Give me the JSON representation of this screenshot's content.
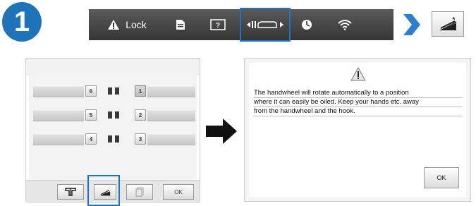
{
  "step": {
    "number": "1",
    "color": "#1f74b9"
  },
  "toolbar": {
    "lock_label": "Lock",
    "icons": [
      "warning-icon",
      "document-icon",
      "help-icon",
      "needle-position-icon",
      "clock-icon",
      "wifi-icon"
    ],
    "highlight_color": "#1a76c4"
  },
  "left_screen": {
    "rows": [
      {
        "left_num": "6",
        "right_num": "1"
      },
      {
        "left_num": "5",
        "right_num": "2"
      },
      {
        "left_num": "4",
        "right_num": "3"
      }
    ],
    "selected_num": "1",
    "footer": {
      "ok_label": "OK"
    }
  },
  "dialog": {
    "lines": [
      "The handwheel will rotate automatically to a position",
      "where it can easily be oiled. Keep your hands etc. away",
      "from the handwheel and the hook."
    ],
    "ok_label": "OK"
  }
}
